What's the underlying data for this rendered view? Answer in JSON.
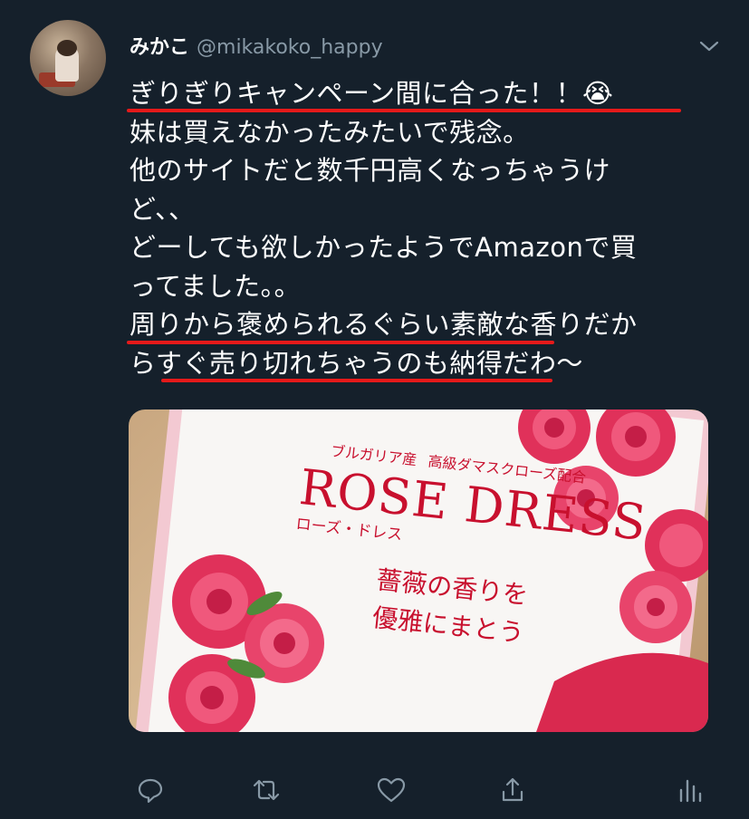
{
  "user": {
    "name": "みかこ",
    "handle": "@mikakoko_happy"
  },
  "tweet": {
    "lines": [
      "ぎりぎりキャンペーン間に合った！！😭",
      "妹は買えなかったみたいで残念。",
      "他のサイトだと数千円高くなっちゃうけ",
      "ど、、",
      "どーしても欲しかったようでAmazonで買",
      "ってました。。",
      "周りから褒められるぐらい素敵な香りだか",
      "らすぐ売り切れちゃうのも納得だわ〜"
    ]
  },
  "media": {
    "origin": "ブルガリア産",
    "grade": "高級ダマスクローズ配合",
    "brand": "ROSE DRESS",
    "brand_kana": "ローズ・ドレス",
    "tagline_1": "薔薇の香りを",
    "tagline_2": "優雅にまとう"
  },
  "actions": {
    "reply": "reply-icon",
    "retweet": "retweet-icon",
    "like": "heart-icon",
    "share": "share-icon",
    "analytics": "analytics-icon"
  },
  "colors": {
    "background": "#15202b",
    "text": "#ffffff",
    "muted": "#8899a6",
    "underline": "#e51a1a",
    "rose": "#e0315a"
  }
}
